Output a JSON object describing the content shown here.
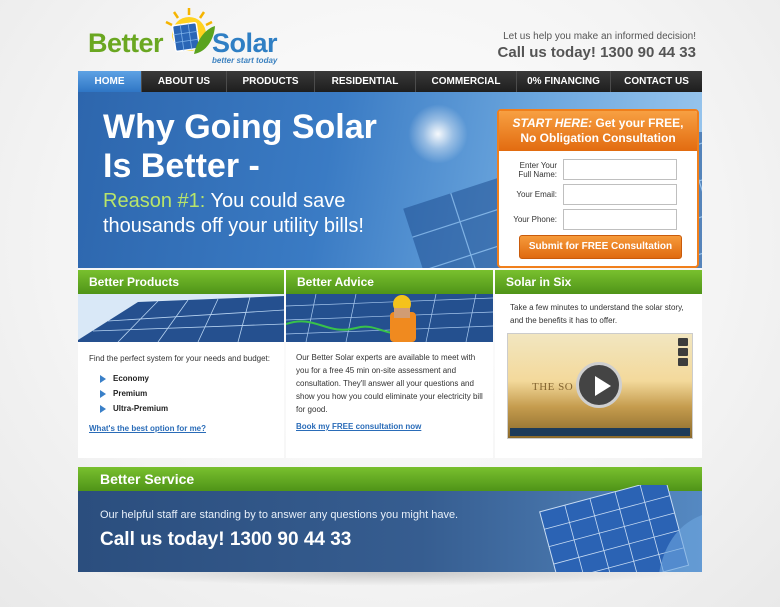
{
  "logo": {
    "word1": "Better",
    "word2": "Solar",
    "tagline": "better start today"
  },
  "header": {
    "tagline": "Let us help you make an informed decision!",
    "phone": "Call us today! 1300 90 44 33"
  },
  "nav": [
    {
      "label": "HOME",
      "active": true
    },
    {
      "label": "ABOUT US"
    },
    {
      "label": "PRODUCTS"
    },
    {
      "label": "RESIDENTIAL"
    },
    {
      "label": "COMMERCIAL"
    },
    {
      "label": "0% FINANCING"
    },
    {
      "label": "CONTACT US"
    }
  ],
  "hero": {
    "title_line1": "Why Going Solar",
    "title_line2": "Is Better -",
    "reason_prefix": "Reason #1:",
    "reason_rest": " You could save",
    "reason_line2": "thousands off your utility bills!"
  },
  "form": {
    "title_em": "START HERE:",
    "title_rest": " Get your FREE,",
    "title_line2": "No Obligation Consultation",
    "name_label_line1": "Enter Your",
    "name_label_line2": "Full Name:",
    "email_label": "Your Email:",
    "phone_label": "Your Phone:",
    "submit_label": "Submit for FREE Consultation"
  },
  "columns": {
    "products": {
      "heading": "Better Products",
      "intro": "Find the perfect system for your needs and budget:",
      "bullets": [
        "Economy",
        "Premium",
        "Ultra-Premium"
      ],
      "link": "What's the best option for me?"
    },
    "advice": {
      "heading": "Better Advice",
      "body": "Our Better Solar experts are available to meet with you for a free 45 min on-site assessment and consultation. They'll answer all your questions and show you how you could eliminate your electricity bill for good.",
      "link": "Book my FREE consultation now"
    },
    "six": {
      "heading": "Solar in Six",
      "body": "Take a few minutes to understand the solar story, and the benefits it has to offer.",
      "video_text": "THE SO          LUTION"
    }
  },
  "service": {
    "heading": "Better Service",
    "text": "Our helpful staff are standing by to answer any questions you might have.",
    "phone": "Call us today! 1300 90 44 33"
  },
  "colors": {
    "green": "#5aa31f",
    "blue": "#2f7fc4",
    "orange": "#e9761a",
    "nav": "#2a2a2a"
  },
  "icons": {
    "play": "play-icon",
    "bullet": "arrow-right-icon"
  }
}
